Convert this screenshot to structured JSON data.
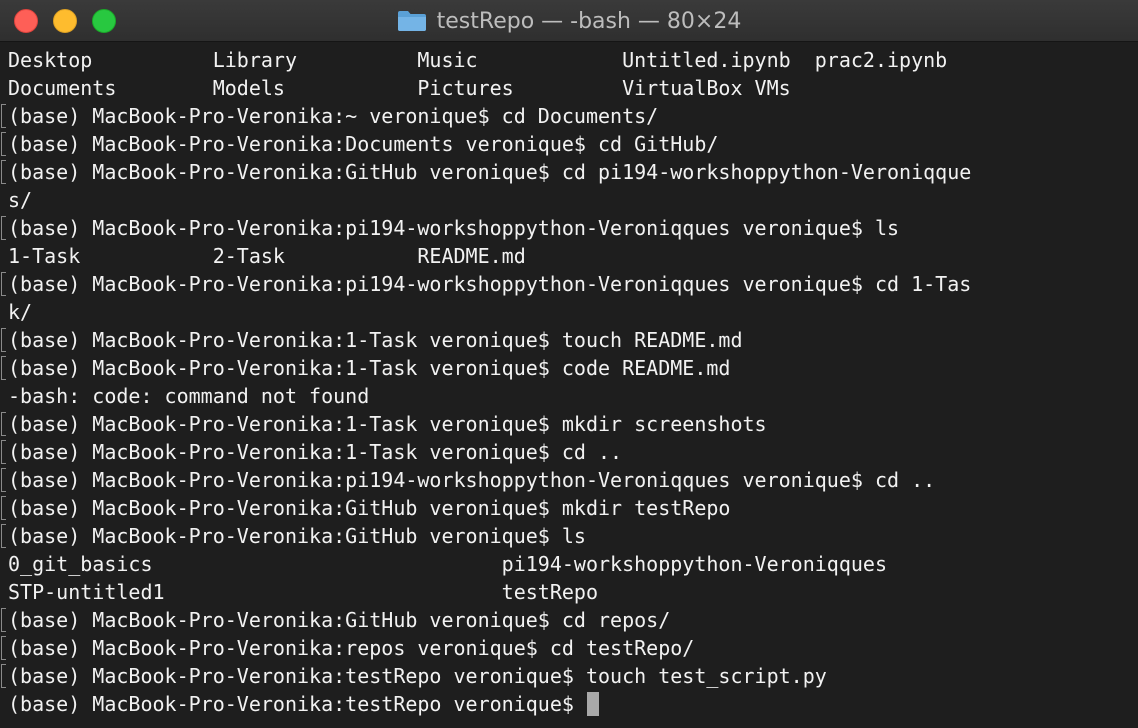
{
  "window": {
    "title": "testRepo — -bash — 80×24",
    "folder_icon": "folder-icon"
  },
  "colors": {
    "background": "#1e1e1e",
    "text": "#f2f2f2",
    "titlebar": "#333333",
    "close": "#fe5f57",
    "minimize": "#febc2e",
    "maximize": "#28c840"
  },
  "terminal": {
    "lines": [
      {
        "text": "Desktop          Library          Music            Untitled.ipynb  prac2.ipynb",
        "marked": false
      },
      {
        "text": "Documents        Models           Pictures         VirtualBox VMs",
        "marked": false
      },
      {
        "text": "(base) MacBook-Pro-Veronika:~ veronique$ cd Documents/",
        "marked": true
      },
      {
        "text": "(base) MacBook-Pro-Veronika:Documents veronique$ cd GitHub/",
        "marked": true
      },
      {
        "text": "(base) MacBook-Pro-Veronika:GitHub veronique$ cd pi194-workshoppython-Veroniqque",
        "marked": true
      },
      {
        "text": "s/",
        "marked": false
      },
      {
        "text": "(base) MacBook-Pro-Veronika:pi194-workshoppython-Veroniqques veronique$ ls",
        "marked": true
      },
      {
        "text": "1-Task           2-Task           README.md",
        "marked": false
      },
      {
        "text": "(base) MacBook-Pro-Veronika:pi194-workshoppython-Veroniqques veronique$ cd 1-Tas",
        "marked": true
      },
      {
        "text": "k/",
        "marked": false
      },
      {
        "text": "(base) MacBook-Pro-Veronika:1-Task veronique$ touch README.md",
        "marked": true
      },
      {
        "text": "(base) MacBook-Pro-Veronika:1-Task veronique$ code README.md",
        "marked": true
      },
      {
        "text": "-bash: code: command not found",
        "marked": false
      },
      {
        "text": "(base) MacBook-Pro-Veronika:1-Task veronique$ mkdir screenshots",
        "marked": true
      },
      {
        "text": "(base) MacBook-Pro-Veronika:1-Task veronique$ cd ..",
        "marked": true
      },
      {
        "text": "(base) MacBook-Pro-Veronika:pi194-workshoppython-Veroniqques veronique$ cd ..",
        "marked": true
      },
      {
        "text": "(base) MacBook-Pro-Veronika:GitHub veronique$ mkdir testRepo",
        "marked": true
      },
      {
        "text": "(base) MacBook-Pro-Veronika:GitHub veronique$ ls",
        "marked": true
      },
      {
        "text": "0_git_basics                             pi194-workshoppython-Veroniqques",
        "marked": false
      },
      {
        "text": "STP-untitled1                            testRepo",
        "marked": false
      },
      {
        "text": "(base) MacBook-Pro-Veronika:GitHub veronique$ cd repos/",
        "marked": true
      },
      {
        "text": "(base) MacBook-Pro-Veronika:repos veronique$ cd testRepo/",
        "marked": true
      },
      {
        "text": "(base) MacBook-Pro-Veronika:testRepo veronique$ touch test_script.py",
        "marked": true
      }
    ],
    "prompt": "(base) MacBook-Pro-Veronika:testRepo veronique$"
  }
}
